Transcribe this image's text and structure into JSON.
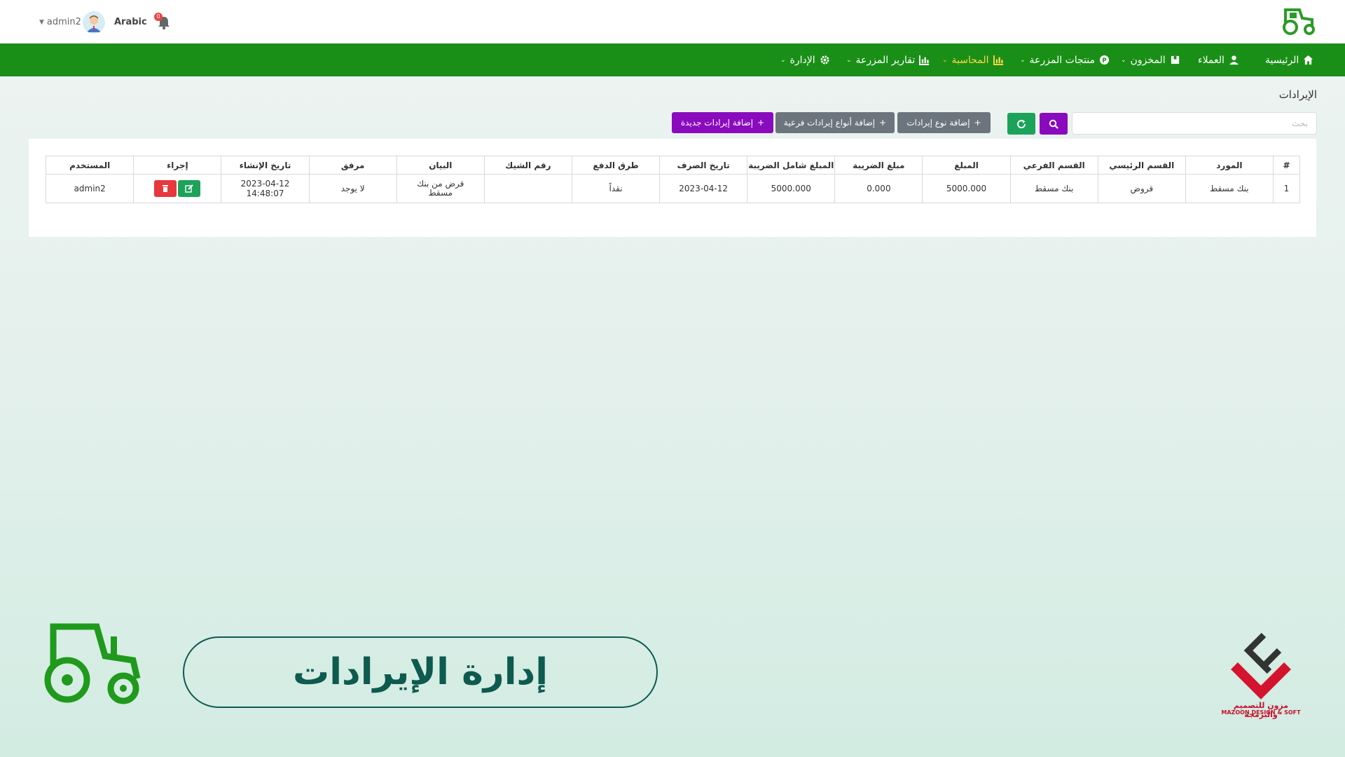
{
  "topbar": {
    "username": "admin2",
    "language": "Arabic",
    "notification_count": "0"
  },
  "nav": {
    "items": [
      {
        "label": "الرئيسية",
        "icon": "home-icon"
      },
      {
        "label": "العملاء",
        "icon": "user-icon"
      },
      {
        "label": "المخزون",
        "icon": "box-icon"
      },
      {
        "label": "منتجات المزرعة",
        "icon": "product-icon"
      },
      {
        "label": "المحاسبة",
        "icon": "chart-icon"
      },
      {
        "label": "تقارير المزرعة",
        "icon": "chart-icon"
      },
      {
        "label": "الإدارة",
        "icon": "gear-icon"
      }
    ],
    "active_color": "#ffd64a"
  },
  "page": {
    "title": "الإيرادات"
  },
  "toolbar": {
    "search_placeholder": "بحث",
    "add_type_label": "إضافة نوع إيرادات",
    "add_subtypes_label": "إضافة أنواع إيرادات فرعية",
    "add_new_label": "إضافة إيرادات جديدة"
  },
  "table": {
    "headers": [
      "#",
      "المورد",
      "القسم الرئيسي",
      "القسم الفرعي",
      "المبلغ",
      "مبلغ الضريبة",
      "المبلغ شامل الضريبة",
      "تاريخ الصرف",
      "طرق الدفع",
      "رقم الشيك",
      "البيان",
      "مرفق",
      "تاريخ الإنشاء",
      "إجراء",
      "المستخدم"
    ],
    "rows": [
      [
        "1",
        "بنك مسقط",
        "قروض",
        "بنك مسقط",
        "5000.000",
        "0.000",
        "5000.000",
        "2023-04-12",
        "نقداً",
        "",
        "قرض من بنك مسقط",
        "لا يوجد",
        "2023-04-12 14:48:07",
        "",
        "admin2"
      ]
    ]
  },
  "banner": {
    "title": "إدارة الإيرادات"
  },
  "brand": {
    "name_ar": "مزون للتصميم والبرمجة",
    "name_en": "MAZOON DESIGN & SOFT"
  },
  "colors": {
    "nav_green": "#1a8f17",
    "purple": "#8a0bbd",
    "green_button": "#1ba35a",
    "delete_red": "#e8373d",
    "banner_text": "#0e5a4f"
  }
}
